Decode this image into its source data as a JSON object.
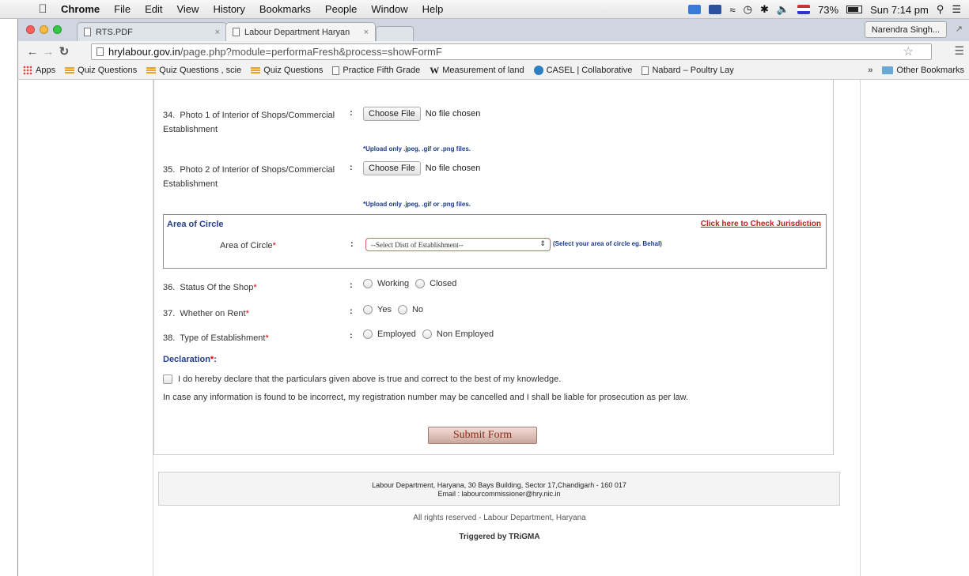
{
  "menubar": {
    "app": "Chrome",
    "items": [
      "File",
      "Edit",
      "View",
      "History",
      "Bookmarks",
      "People",
      "Window",
      "Help"
    ],
    "battery": "73%",
    "clock": "Sun 7:14 pm"
  },
  "tabs": [
    {
      "label": "RTS.PDF"
    },
    {
      "label": "Labour Department Haryan"
    }
  ],
  "profile": "Narendra Singh...",
  "omnibox": {
    "host": "hrylabour.gov.in",
    "path": "/page.php?module=performaFresh&process=showFormF"
  },
  "bookmarks": [
    {
      "label": "Apps",
      "icon": "grid-icon"
    },
    {
      "label": "Quiz Questions",
      "icon": "bookmark-lines-icon"
    },
    {
      "label": "Quiz Questions , scie",
      "icon": "bookmark-lines-icon"
    },
    {
      "label": "Quiz Questions",
      "icon": "bookmark-lines-icon"
    },
    {
      "label": "Practice Fifth Grade",
      "icon": "doc-icon"
    },
    {
      "label": "Measurement of land",
      "icon": "wikipedia-icon"
    },
    {
      "label": "CASEL | Collaborative",
      "icon": "casel-icon"
    },
    {
      "label": "Nabard – Poultry Lay",
      "icon": "doc-icon"
    }
  ],
  "other_bookmarks": "Other Bookmarks",
  "form": {
    "photo1": {
      "num": "34.",
      "label": "Photo 1 of Interior of Shops/Commercial Establishment",
      "button": "Choose File",
      "status": "No file chosen",
      "hint": "*Upload only .jpeg, .gif or .png files."
    },
    "photo2": {
      "num": "35.",
      "label": "Photo 2 of Interior of Shops/Commercial Establishment",
      "button": "Choose File",
      "status": "No file chosen",
      "hint": "*Upload only .jpeg, .gif or .png files."
    },
    "circle": {
      "title": "Area of Circle",
      "jurisdiction_link": "Click here to Check Jurisdiction",
      "label": "Area of Circle",
      "select_value": "--Select Distt of Establishment--",
      "note": "(Select your area of circle eg. Behal)"
    },
    "status": {
      "num": "36.",
      "label": "Status Of the Shop",
      "options": [
        "Working",
        "Closed"
      ]
    },
    "rent": {
      "num": "37.",
      "label": "Whether on Rent",
      "options": [
        "Yes",
        "No"
      ]
    },
    "type": {
      "num": "38.",
      "label": "Type of Establishment",
      "options": [
        "Employed",
        "Non Employed"
      ]
    },
    "declaration_title": "Declaration",
    "declaration_text": "I do hereby declare that the particulars given above is true and correct to the best of my knowledge.",
    "declaration_text2": "In case any information is found to be incorrect, my registration number may be cancelled and I shall be liable for prosecution as per law.",
    "submit": "Submit Form"
  },
  "footer": {
    "address": "Labour Department, Haryana, 30 Bays Building, Sector 17,Chandigarh - 160 017",
    "email": "Email : labourcommissioner@hry.nic.in",
    "rights": "All rights reserved - Labour Department, Haryana",
    "triggered": "Triggered by TRiGMA"
  }
}
